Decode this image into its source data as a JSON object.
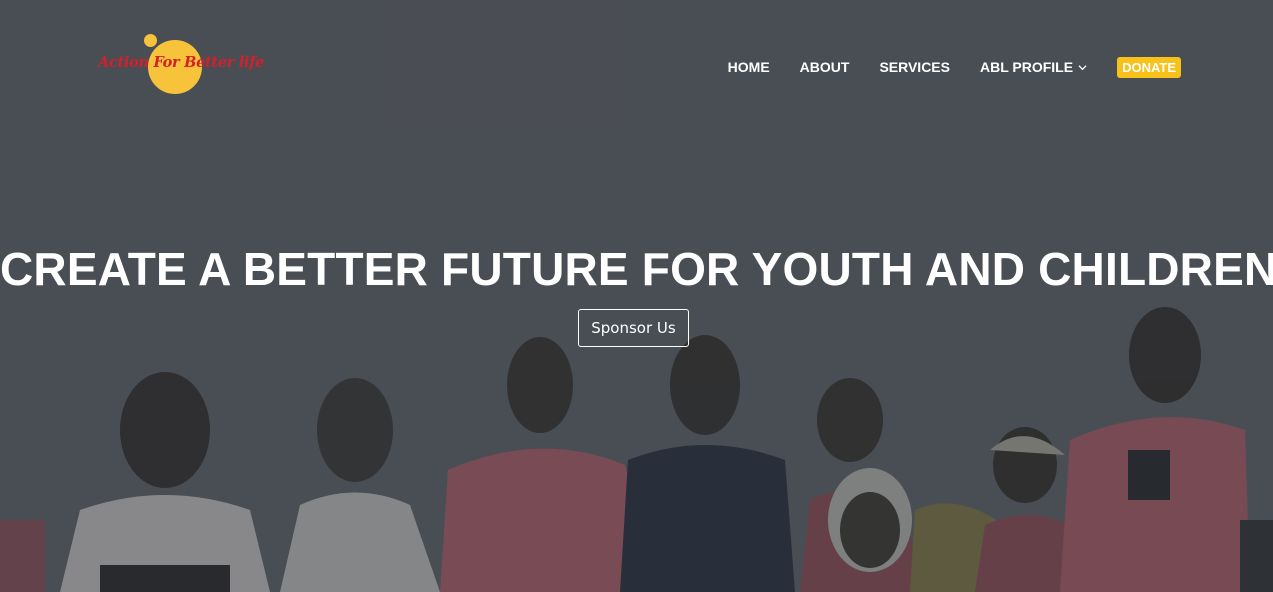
{
  "brand": {
    "logo_text": "Action For Better life",
    "logo_color": "#d4202a",
    "logo_circle_color": "#f6c33a"
  },
  "nav": {
    "items": [
      {
        "label": "HOME"
      },
      {
        "label": "ABOUT"
      },
      {
        "label": "SERVICES"
      },
      {
        "label": "ABL PROFILE",
        "icon": "chevron-down-icon"
      }
    ],
    "donate_label": "DONATE",
    "donate_color": "#f7c21a"
  },
  "hero": {
    "title": "CREATE A BETTER FUTURE FOR YOUTH AND CHILDREN",
    "cta_label": "Sponsor Us",
    "background_image": "group-of-youth-photo"
  }
}
